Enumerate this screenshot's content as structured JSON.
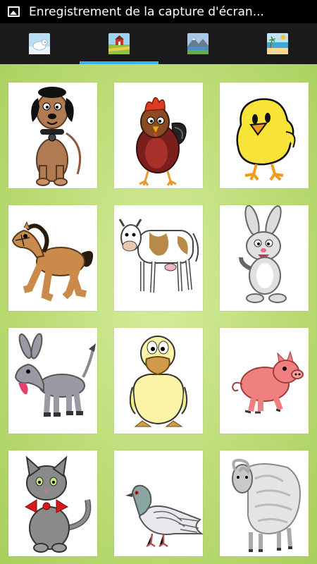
{
  "statusbar": {
    "notification_icon": "image-icon",
    "title": "Enregistrement de la capture d'écran..."
  },
  "tabs": [
    {
      "icon": "polar-bear-scene-icon",
      "active": false
    },
    {
      "icon": "farm-barn-scene-icon",
      "active": true
    },
    {
      "icon": "mountain-lake-scene-icon",
      "active": false
    },
    {
      "icon": "beach-scene-icon",
      "active": false
    }
  ],
  "animals": [
    "dog",
    "rooster",
    "chick",
    "horse",
    "cow",
    "rabbit",
    "donkey",
    "duck",
    "pig",
    "cat",
    "pigeon",
    "sheep"
  ],
  "colors": {
    "accent": "#33b5e5",
    "background_green": "#bcdc76",
    "tile": "#ffffff"
  }
}
